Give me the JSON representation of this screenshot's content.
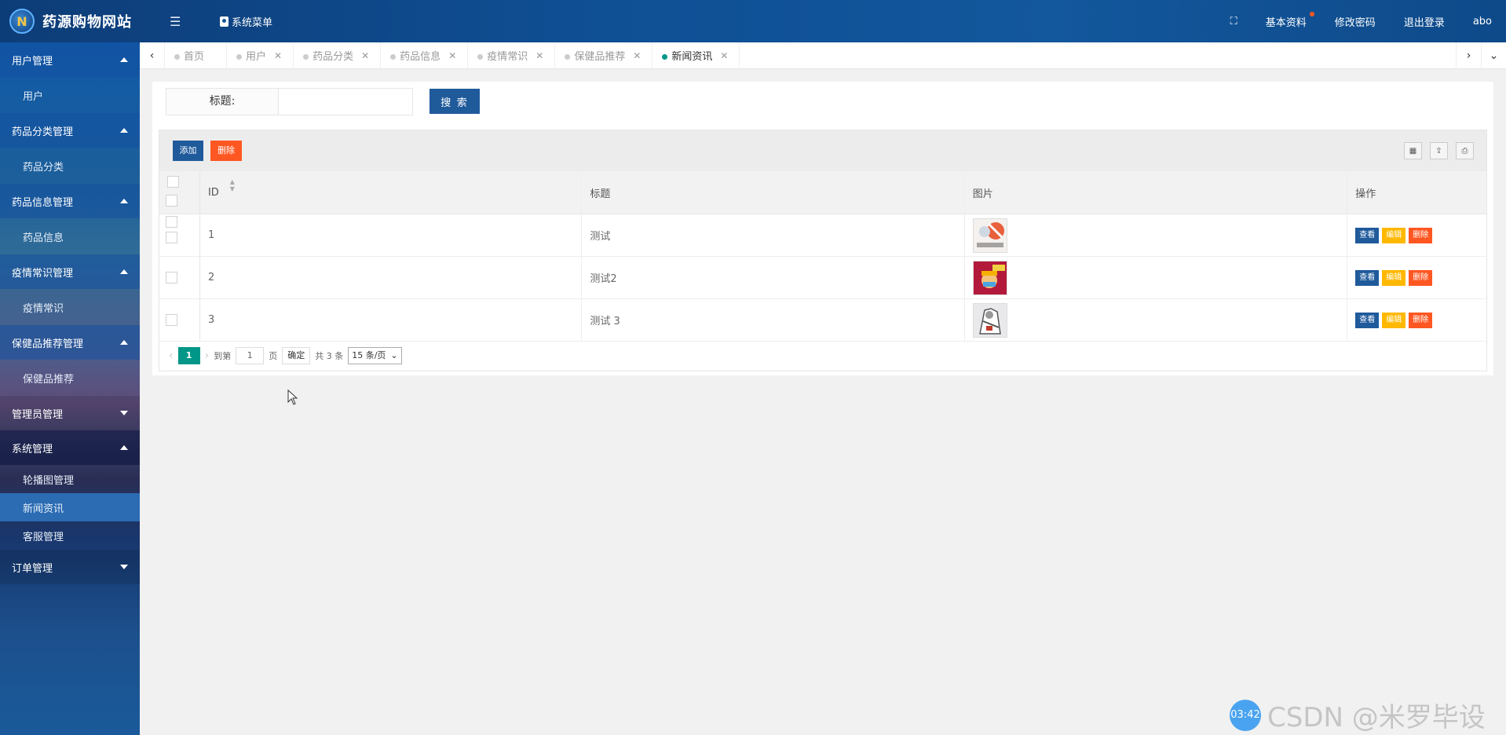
{
  "header": {
    "site_title": "药源购物网站",
    "system_menu": "系统菜单",
    "right_items": [
      "基本资料",
      "修改密码",
      "退出登录",
      "abo"
    ]
  },
  "sidebar": {
    "groups": [
      {
        "label": "用户管理",
        "expanded": true,
        "items": [
          "用户"
        ]
      },
      {
        "label": "药品分类管理",
        "expanded": true,
        "items": [
          "药品分类"
        ]
      },
      {
        "label": "药品信息管理",
        "expanded": true,
        "items": [
          "药品信息"
        ]
      },
      {
        "label": "疫情常识管理",
        "expanded": true,
        "items": [
          "疫情常识"
        ]
      },
      {
        "label": "保健品推荐管理",
        "expanded": true,
        "items": [
          "保健品推荐"
        ]
      },
      {
        "label": "管理员管理",
        "expanded": false,
        "items": []
      },
      {
        "label": "系统管理",
        "expanded": true,
        "items": [
          "轮播图管理",
          "新闻资讯",
          "客服管理"
        ]
      },
      {
        "label": "订单管理",
        "expanded": false,
        "items": []
      }
    ],
    "active_item": "新闻资讯"
  },
  "tabs": {
    "items": [
      "首页",
      "用户",
      "药品分类",
      "药品信息",
      "疫情常识",
      "保健品推荐",
      "新闻资讯"
    ],
    "active": "新闻资讯"
  },
  "search": {
    "label": "标题:",
    "value": "",
    "button": "搜 索"
  },
  "toolbar": {
    "add": "添加",
    "delete": "删除"
  },
  "table": {
    "columns": [
      "ID",
      "标题",
      "图片",
      "操作"
    ],
    "rows": [
      {
        "id": "1",
        "title": "测试"
      },
      {
        "id": "2",
        "title": "测试2"
      },
      {
        "id": "3",
        "title": "测试 3"
      }
    ],
    "actions": {
      "view": "查看",
      "edit": "编辑",
      "delete": "删除"
    }
  },
  "pagination": {
    "current": "1",
    "goto_prefix": "到第",
    "goto_value": "1",
    "goto_suffix": "页",
    "confirm": "确定",
    "total": "共 3 条",
    "per_page": "15 条/页"
  },
  "overlay": {
    "time": "03:42",
    "watermark": "CSDN @米罗毕设"
  },
  "colors": {
    "primary": "#1f5a9b",
    "danger": "#ff5722",
    "warning": "#ffb800",
    "teal": "#009688"
  }
}
